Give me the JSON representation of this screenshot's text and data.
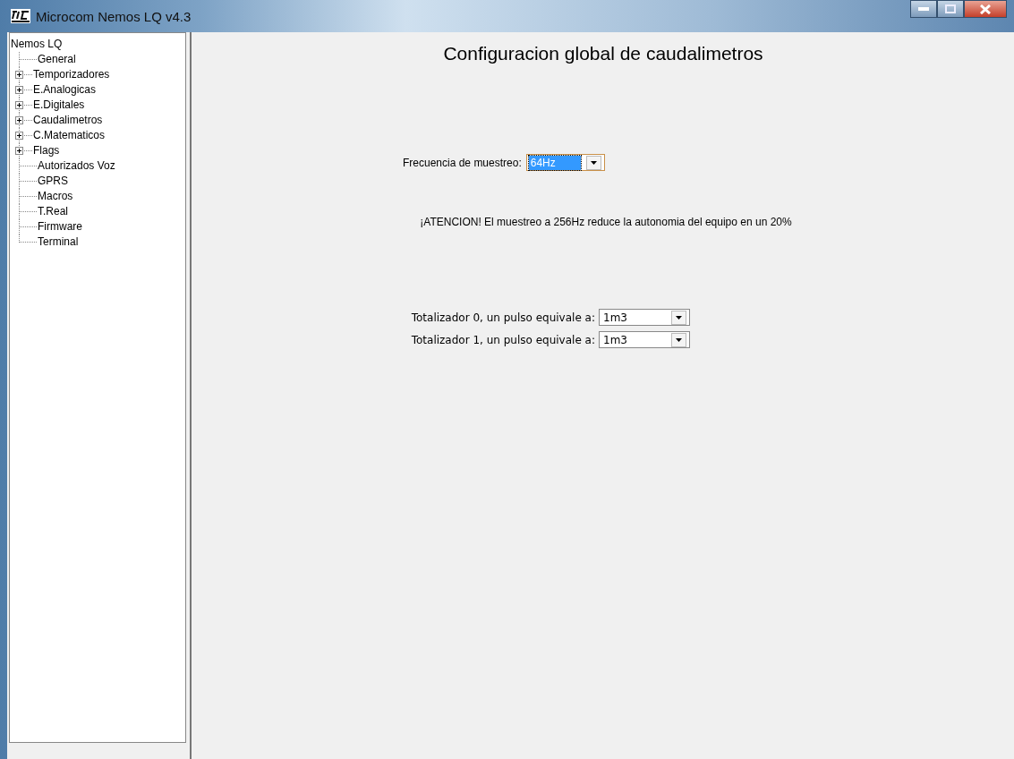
{
  "window": {
    "title": "Microcom Nemos LQ v4.3"
  },
  "tree": {
    "label": "Nemos LQ",
    "children": [
      {
        "label": "General",
        "kind": "leaf"
      },
      {
        "label": "Temporizadores",
        "kind": "collapsed"
      },
      {
        "label": "E.Analogicas",
        "kind": "collapsed"
      },
      {
        "label": "E.Digitales",
        "kind": "collapsed"
      },
      {
        "label": "Caudalimetros",
        "kind": "collapsed"
      },
      {
        "label": "C.Matematicos",
        "kind": "collapsed"
      },
      {
        "label": "Flags",
        "kind": "collapsed"
      },
      {
        "label": "Autorizados Voz",
        "kind": "leaf"
      },
      {
        "label": "GPRS",
        "kind": "leaf"
      },
      {
        "label": "Macros",
        "kind": "leaf"
      },
      {
        "label": "T.Real",
        "kind": "leaf"
      },
      {
        "label": "Firmware",
        "kind": "leaf"
      },
      {
        "label": "Terminal",
        "kind": "leaf"
      }
    ]
  },
  "panel": {
    "title": "Configuracion global de caudalimetros",
    "frequency": {
      "label": "Frecuencia de muestreo:",
      "value": "64Hz",
      "focused": true
    },
    "warning": "¡ATENCION! El muestreo a 256Hz reduce la autonomia del equipo en un 20%",
    "totalizers": [
      {
        "label": "Totalizador 0, un pulso equivale a:",
        "value": "1m3",
        "focused": false
      },
      {
        "label": "Totalizador 1, un pulso equivale a:",
        "value": "1m3",
        "focused": false
      }
    ]
  }
}
